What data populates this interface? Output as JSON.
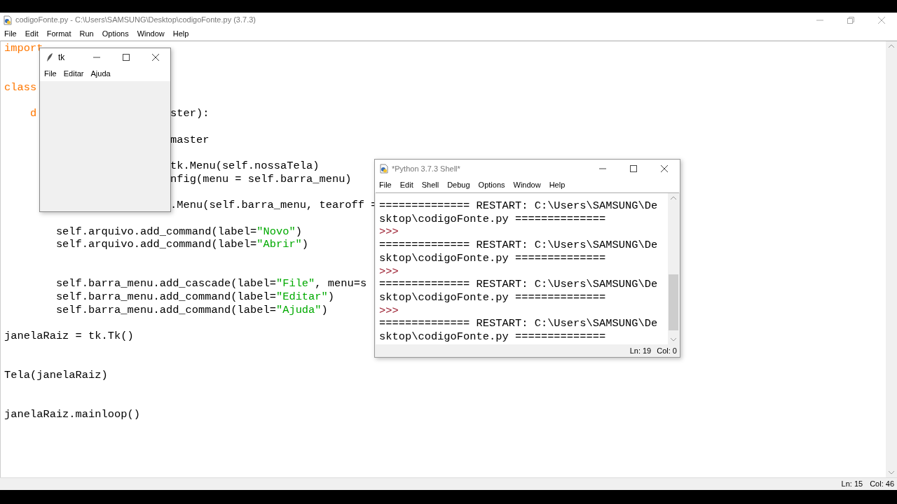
{
  "window": {
    "title": "codigoFonte.py - C:\\Users\\SAMSUNG\\Desktop\\codigoFonte.py (3.7.3)"
  },
  "menu": [
    "File",
    "Edit",
    "Format",
    "Run",
    "Options",
    "Window",
    "Help"
  ],
  "editor": {
    "lines": [
      {
        "kind": "code",
        "before": [
          {
            "text": "import",
            "kind": "keyword"
          }
        ]
      },
      {
        "kind": "blank"
      },
      {
        "kind": "blank"
      },
      {
        "kind": "code",
        "before": [
          {
            "text": "class",
            "kind": "keyword"
          }
        ]
      },
      {
        "kind": "blank"
      },
      {
        "kind": "code",
        "before": [
          {
            "text": "    d",
            "kind": "keyword"
          }
        ],
        "after": [
          {
            "text": "ster):",
            "kind": "plain"
          }
        ]
      },
      {
        "kind": "blank"
      },
      {
        "kind": "code",
        "after": [
          {
            "text": "master",
            "kind": "plain"
          }
        ]
      },
      {
        "kind": "blank"
      },
      {
        "kind": "code",
        "after": [
          {
            "text": "tk.Menu(self.nossaTela)",
            "kind": "plain"
          }
        ]
      },
      {
        "kind": "code",
        "after": [
          {
            "text": "nfig(menu = self.barra_menu)",
            "kind": "plain"
          }
        ]
      },
      {
        "kind": "blank"
      },
      {
        "kind": "code",
        "after": [
          {
            "text": ".Menu(self.barra_menu, tearoff =",
            "kind": "plain"
          }
        ]
      },
      {
        "kind": "blank"
      },
      {
        "kind": "code",
        "before": [
          {
            "text": "        self.arquivo.add_command(label=",
            "kind": "plain"
          },
          {
            "text": "\"Novo\"",
            "kind": "string"
          },
          {
            "text": ")",
            "kind": "plain"
          }
        ]
      },
      {
        "kind": "code",
        "before": [
          {
            "text": "        self.arquivo.add_command(label=",
            "kind": "plain"
          },
          {
            "text": "\"Abrir\"",
            "kind": "string"
          },
          {
            "text": ")",
            "kind": "plain"
          }
        ]
      },
      {
        "kind": "blank"
      },
      {
        "kind": "blank"
      },
      {
        "kind": "code",
        "before": [
          {
            "text": "        self.barra_menu.add_cascade(label=",
            "kind": "plain"
          },
          {
            "text": "\"File\"",
            "kind": "string"
          },
          {
            "text": ", menu=s",
            "kind": "plain"
          }
        ]
      },
      {
        "kind": "code",
        "before": [
          {
            "text": "        self.barra_menu.add_command(label=",
            "kind": "plain"
          },
          {
            "text": "\"Editar\"",
            "kind": "string"
          },
          {
            "text": ")",
            "kind": "plain"
          }
        ]
      },
      {
        "kind": "code",
        "before": [
          {
            "text": "        self.barra_menu.add_command(label=",
            "kind": "plain"
          },
          {
            "text": "\"Ajuda\"",
            "kind": "string"
          },
          {
            "text": ")",
            "kind": "plain"
          }
        ]
      },
      {
        "kind": "blank"
      },
      {
        "kind": "code",
        "before": [
          {
            "text": "janelaRaiz = tk.Tk()",
            "kind": "plain"
          }
        ]
      },
      {
        "kind": "blank"
      },
      {
        "kind": "blank"
      },
      {
        "kind": "code",
        "before": [
          {
            "text": "Tela(janelaRaiz)",
            "kind": "plain"
          }
        ]
      },
      {
        "kind": "blank"
      },
      {
        "kind": "blank"
      },
      {
        "kind": "code",
        "before": [
          {
            "text": "janelaRaiz.mainloop()",
            "kind": "plain"
          }
        ]
      }
    ]
  },
  "status_bar": {
    "line": "Ln: 15",
    "col": "Col: 46"
  },
  "tk_window": {
    "title": "tk",
    "menu": [
      "File",
      "Editar",
      "Ajuda"
    ]
  },
  "shell": {
    "title": "*Python 3.7.3 Shell*",
    "menu": [
      "File",
      "Edit",
      "Shell",
      "Debug",
      "Options",
      "Window",
      "Help"
    ],
    "lines": [
      {
        "kind": "output",
        "text": "============== RESTART: C:\\Users\\SAMSUNG\\De"
      },
      {
        "kind": "output",
        "text": "sktop\\codigoFonte.py =============="
      },
      {
        "kind": "prompt",
        "text": ">>>"
      },
      {
        "kind": "output",
        "text": "============== RESTART: C:\\Users\\SAMSUNG\\De"
      },
      {
        "kind": "output",
        "text": "sktop\\codigoFonte.py =============="
      },
      {
        "kind": "prompt",
        "text": ">>>"
      },
      {
        "kind": "output",
        "text": "============== RESTART: C:\\Users\\SAMSUNG\\De"
      },
      {
        "kind": "output",
        "text": "sktop\\codigoFonte.py =============="
      },
      {
        "kind": "prompt",
        "text": ">>>"
      },
      {
        "kind": "output",
        "text": "============== RESTART: C:\\Users\\SAMSUNG\\De"
      },
      {
        "kind": "output",
        "text": "sktop\\codigoFonte.py =============="
      }
    ],
    "status_bar": {
      "line": "Ln: 19",
      "col": "Col: 0"
    }
  }
}
